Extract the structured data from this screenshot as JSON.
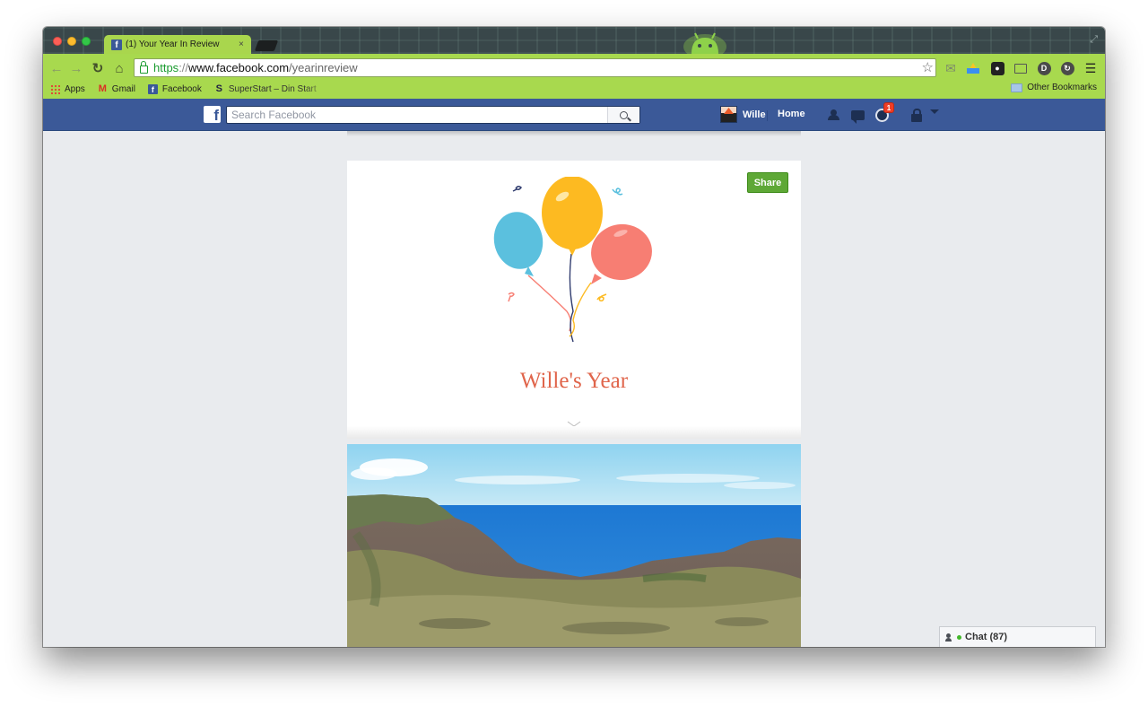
{
  "browser": {
    "tab_title": "(1) Your Year In Review",
    "tab_close": "×",
    "url": {
      "scheme": "https",
      "separator": "://",
      "host": "www.facebook.com",
      "path": "/yearinreview"
    },
    "bookmarks": [
      {
        "label": "Apps",
        "icon": "apps-grid-icon"
      },
      {
        "label": "Gmail",
        "icon": "gmail-icon"
      },
      {
        "label": "Facebook",
        "icon": "facebook-icon"
      },
      {
        "label": "SuperStart – Din Start",
        "icon": "superstart-icon"
      }
    ],
    "other_bookmarks": "Other Bookmarks",
    "theme_colors": {
      "tabstrip": "#39474a",
      "toolbar": "#a8d94e"
    }
  },
  "facebook": {
    "search_placeholder": "Search Facebook",
    "user_name": "Wille",
    "home_label": "Home",
    "notification_count": "1",
    "brand_color": "#3b5998"
  },
  "year_review": {
    "share_label": "Share",
    "title": "Wille's Year",
    "title_color": "#e0654b",
    "balloon_colors": [
      "#5bc0de",
      "#fdba21",
      "#f77e73"
    ]
  },
  "chat": {
    "label": "Chat (87)"
  }
}
